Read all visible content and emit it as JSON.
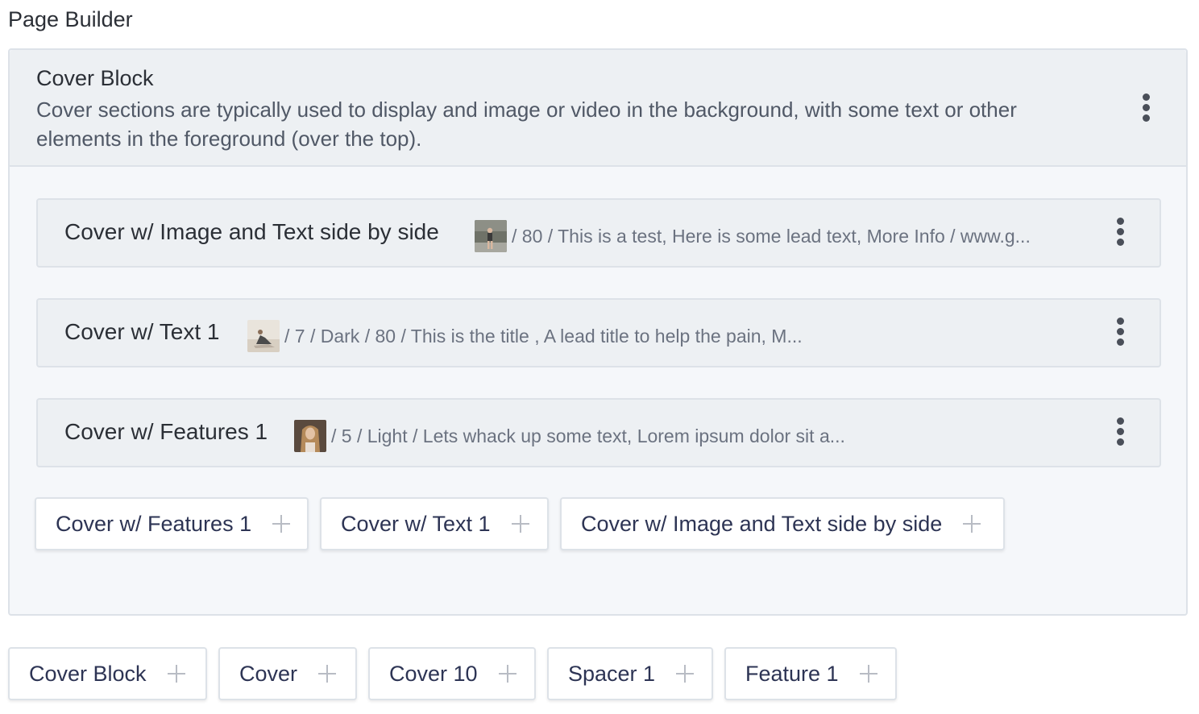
{
  "page": {
    "title": "Page Builder"
  },
  "cover_block": {
    "title": "Cover Block",
    "description": "Cover sections are typically used to display and image or video in the background, with some text or other elements in the foreground (over the top).",
    "rows": [
      {
        "title": "Cover w/ Image and Text side by side",
        "summary": "/ 80 / This is a test, Here is some lead text, More Info / www.g...",
        "thumb": "person-standing-photo"
      },
      {
        "title": "Cover w/ Text 1",
        "summary": "/ 7 / Dark / 80 / This is the title , A lead title to help the pain, M...",
        "thumb": "person-sitting-beach-photo"
      },
      {
        "title": "Cover w/ Features 1",
        "summary": "/ 5 / Light / Lets whack up some text, Lorem ipsum dolor sit a...",
        "thumb": "woman-portrait-photo"
      }
    ],
    "add_buttons": [
      {
        "label": "Cover w/ Features 1"
      },
      {
        "label": "Cover w/ Text 1"
      },
      {
        "label": "Cover w/ Image and Text side by side"
      }
    ]
  },
  "bottom_add_buttons": [
    {
      "label": "Cover Block"
    },
    {
      "label": "Cover"
    },
    {
      "label": "Cover 10"
    },
    {
      "label": "Spacer 1"
    },
    {
      "label": "Feature 1"
    }
  ],
  "colors": {
    "panel_bg": "#f5f7fa",
    "header_bg": "#edf0f3",
    "border": "#dde2e8",
    "button_text": "#2d3454"
  },
  "icons": {
    "menu": "kebab-menu-icon",
    "add": "plus-icon"
  }
}
